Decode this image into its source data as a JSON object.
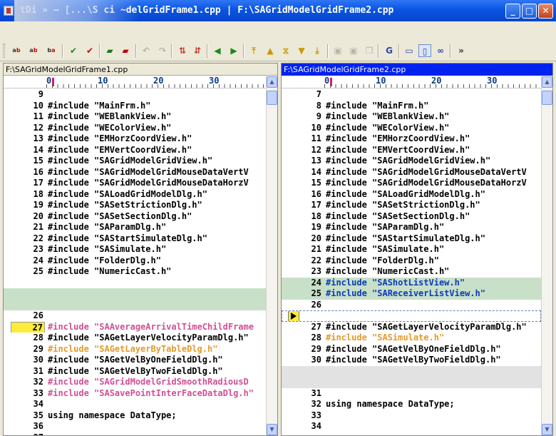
{
  "window": {
    "title": "ebDiff - [...\\S...i...delGridFrame1.cpp | F:\\SAGridModelGridFrame2.cpp]",
    "title_visible": "  tDi » – [...\\S   ci  ~delGridFrame1.cpp | F:\\SAGridModelGridFrame2.cpp",
    "minimize": "_",
    "maximize": "□",
    "close": "✕"
  },
  "toolbar": {
    "icons": [
      "ab-icon",
      "ab-icon",
      "ab-icon",
      "check-icon",
      "check-icon",
      "save-icon",
      "save-icon",
      "undo-icon",
      "redo-icon",
      "swap-arrows-icon",
      "swap-arrows-icon",
      "left-arrow-icon",
      "right-arrow-icon",
      "first-diff-icon",
      "prev-diff-icon",
      "current-diff-icon",
      "next-diff-icon",
      "last-diff-icon",
      "disk-icon",
      "disk-icon",
      "copy-icon",
      "find-icon",
      "view-horizontal-icon",
      "view-vertical-icon",
      "view-binoculars-icon",
      "more-icon"
    ]
  },
  "left": {
    "path": "F:\\SAGridModelGridFrame1.cpp",
    "ruler": [
      "0",
      "10",
      "20",
      "30"
    ],
    "lines": [
      {
        "n": "9",
        "t": "",
        "s": ""
      },
      {
        "n": "10",
        "t": "#include \"MainFrm.h\"",
        "s": ""
      },
      {
        "n": "11",
        "t": "#include \"WEBlankView.h\"",
        "s": ""
      },
      {
        "n": "12",
        "t": "#include \"WEColorView.h\"",
        "s": ""
      },
      {
        "n": "13",
        "t": "#include \"EMHorzCoordView.h\"",
        "s": ""
      },
      {
        "n": "14",
        "t": "#include \"EMVertCoordView.h\"",
        "s": ""
      },
      {
        "n": "15",
        "t": "#include \"SAGridModelGridView.h\"",
        "s": ""
      },
      {
        "n": "16",
        "t": "#include \"SAGridModelGridMouseDataVertV",
        "s": ""
      },
      {
        "n": "17",
        "t": "#include \"SAGridModelGridMouseDataHorzV",
        "s": ""
      },
      {
        "n": "18",
        "t": "#include \"SALoadGridModelDlg.h\"",
        "s": ""
      },
      {
        "n": "19",
        "t": "#include \"SASetStrictionDlg.h\"",
        "s": ""
      },
      {
        "n": "20",
        "t": "#include \"SASetSectionDlg.h\"",
        "s": ""
      },
      {
        "n": "21",
        "t": "#include \"SAParamDlg.h\"",
        "s": ""
      },
      {
        "n": "22",
        "t": "#include \"SAStartSimulateDlg.h\"",
        "s": ""
      },
      {
        "n": "23",
        "t": "#include \"SASimulate.h\"",
        "s": ""
      },
      {
        "n": "24",
        "t": "#include \"FolderDlg.h\"",
        "s": ""
      },
      {
        "n": "25",
        "t": "#include \"NumericCast.h\"",
        "s": ""
      },
      {
        "n": "",
        "t": "",
        "s": ""
      },
      {
        "n": "",
        "t": "",
        "s": "hl-green"
      },
      {
        "n": "",
        "t": "",
        "s": "hl-green"
      },
      {
        "n": "26",
        "t": "",
        "s": ""
      },
      {
        "n": "27",
        "t": "#include \"SAAverageArrivalTimeChildFrame",
        "s": "hl-yellow diff-mod"
      },
      {
        "n": "28",
        "t": "#include \"SAGetLayerVelocityParamDlg.h\"",
        "s": ""
      },
      {
        "n": "29",
        "t": "#include \"SAGetLayerByTableDlg.h\"",
        "s": "diff-orange"
      },
      {
        "n": "30",
        "t": "#include \"SAGetVelByOneFieldDlg.h\"",
        "s": ""
      },
      {
        "n": "31",
        "t": "#include \"SAGetVelByTwoFieldDlg.h\"",
        "s": ""
      },
      {
        "n": "32",
        "t": "#include \"SAGridModelGridSmoothRadiousD",
        "s": "diff-mod"
      },
      {
        "n": "33",
        "t": "#include \"SASavePointInterFaceDataDlg.h\"",
        "s": "diff-mod"
      },
      {
        "n": "34",
        "t": "",
        "s": ""
      },
      {
        "n": "35",
        "t": "using namespace DataType;",
        "s": ""
      },
      {
        "n": "36",
        "t": "",
        "s": ""
      },
      {
        "n": "37",
        "t": "",
        "s": ""
      }
    ]
  },
  "right": {
    "path": "F:\\SAGridModelGridFrame2.cpp",
    "ruler": [
      "0",
      "10",
      "20",
      "30"
    ],
    "lines": [
      {
        "n": "7",
        "t": "",
        "s": ""
      },
      {
        "n": "8",
        "t": "#include \"MainFrm.h\"",
        "s": ""
      },
      {
        "n": "9",
        "t": "#include \"WEBlankView.h\"",
        "s": ""
      },
      {
        "n": "10",
        "t": "#include \"WEColorView.h\"",
        "s": ""
      },
      {
        "n": "11",
        "t": "#include \"EMHorzCoordView.h\"",
        "s": ""
      },
      {
        "n": "12",
        "t": "#include \"EMVertCoordView.h\"",
        "s": ""
      },
      {
        "n": "13",
        "t": "#include \"SAGridModelGridView.h\"",
        "s": ""
      },
      {
        "n": "14",
        "t": "#include \"SAGridModelGridMouseDataVertV",
        "s": ""
      },
      {
        "n": "15",
        "t": "#include \"SAGridModelGridMouseDataHorzV",
        "s": ""
      },
      {
        "n": "16",
        "t": "#include \"SALoadGridModelDlg.h\"",
        "s": ""
      },
      {
        "n": "17",
        "t": "#include \"SASetStrictionDlg.h\"",
        "s": ""
      },
      {
        "n": "18",
        "t": "#include \"SASetSectionDlg.h\"",
        "s": ""
      },
      {
        "n": "19",
        "t": "#include \"SAParamDlg.h\"",
        "s": ""
      },
      {
        "n": "20",
        "t": "#include \"SAStartSimulateDlg.h\"",
        "s": ""
      },
      {
        "n": "21",
        "t": "#include \"SASimulate.h\"",
        "s": ""
      },
      {
        "n": "22",
        "t": "#include \"FolderDlg.h\"",
        "s": ""
      },
      {
        "n": "23",
        "t": "#include \"NumericCast.h\"",
        "s": ""
      },
      {
        "n": "24",
        "t": "#include \"SAShotListView.h\"",
        "s": "hl-green diff-add"
      },
      {
        "n": "25",
        "t": "#include \"SAReceiverListView.h\"",
        "s": "hl-green diff-add"
      },
      {
        "n": "26",
        "t": "",
        "s": ""
      },
      {
        "n": "",
        "t": "",
        "s": "dashed"
      },
      {
        "n": "27",
        "t": "#include \"SAGetLayerVelocityParamDlg.h\"",
        "s": ""
      },
      {
        "n": "28",
        "t": "#include \"SASimulate.h\"",
        "s": "diff-orange"
      },
      {
        "n": "29",
        "t": "#include \"SAGetVelByOneFieldDlg.h\"",
        "s": ""
      },
      {
        "n": "30",
        "t": "#include \"SAGetVelByTwoFieldDlg.h\"",
        "s": ""
      },
      {
        "n": "",
        "t": "",
        "s": "hl-gray"
      },
      {
        "n": "",
        "t": "",
        "s": "hl-gray"
      },
      {
        "n": "31",
        "t": "",
        "s": ""
      },
      {
        "n": "32",
        "t": "using namespace DataType;",
        "s": ""
      },
      {
        "n": "33",
        "t": "",
        "s": ""
      },
      {
        "n": "34",
        "t": "",
        "s": ""
      }
    ]
  }
}
